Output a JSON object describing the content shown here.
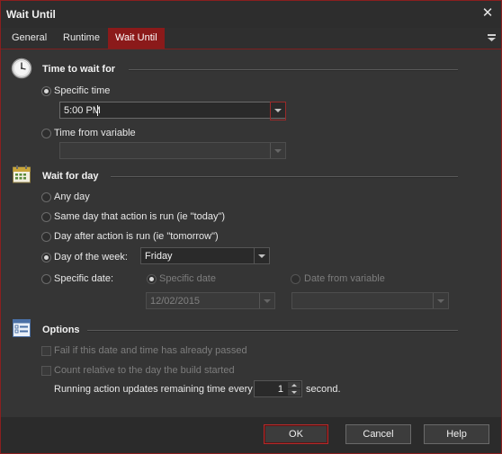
{
  "window": {
    "title": "Wait Until"
  },
  "tabs": [
    {
      "label": "General",
      "active": false
    },
    {
      "label": "Runtime",
      "active": false
    },
    {
      "label": "Wait Until",
      "active": true
    }
  ],
  "time_section": {
    "title": "Time to wait for",
    "specific_time_label": "Specific time",
    "specific_time_value": "5:00 PM",
    "from_variable_label": "Time from variable",
    "from_variable_value": ""
  },
  "day_section": {
    "title": "Wait for day",
    "any_day_label": "Any day",
    "same_day_label": "Same day that action is run (ie \"today\")",
    "day_after_label": "Day after action is run (ie \"tomorrow\")",
    "day_of_week_label": "Day of the week:",
    "day_of_week_value": "Friday",
    "specific_date_label": "Specific date:",
    "sub_specific_date_label": "Specific date",
    "sub_specific_date_value": "12/02/2015",
    "sub_date_variable_label": "Date from variable",
    "sub_date_variable_value": ""
  },
  "options_section": {
    "title": "Options",
    "fail_if_passed_label": "Fail if this date and time has already passed",
    "count_relative_label": "Count relative to the day the build started",
    "update_prefix": "Running action updates remaining time every",
    "update_value": "1",
    "update_suffix": "second."
  },
  "buttons": {
    "ok": "OK",
    "cancel": "Cancel",
    "help": "Help"
  },
  "colors": {
    "accent": "#8b1a1a",
    "background": "#353535",
    "text": "#e8e8e8"
  }
}
